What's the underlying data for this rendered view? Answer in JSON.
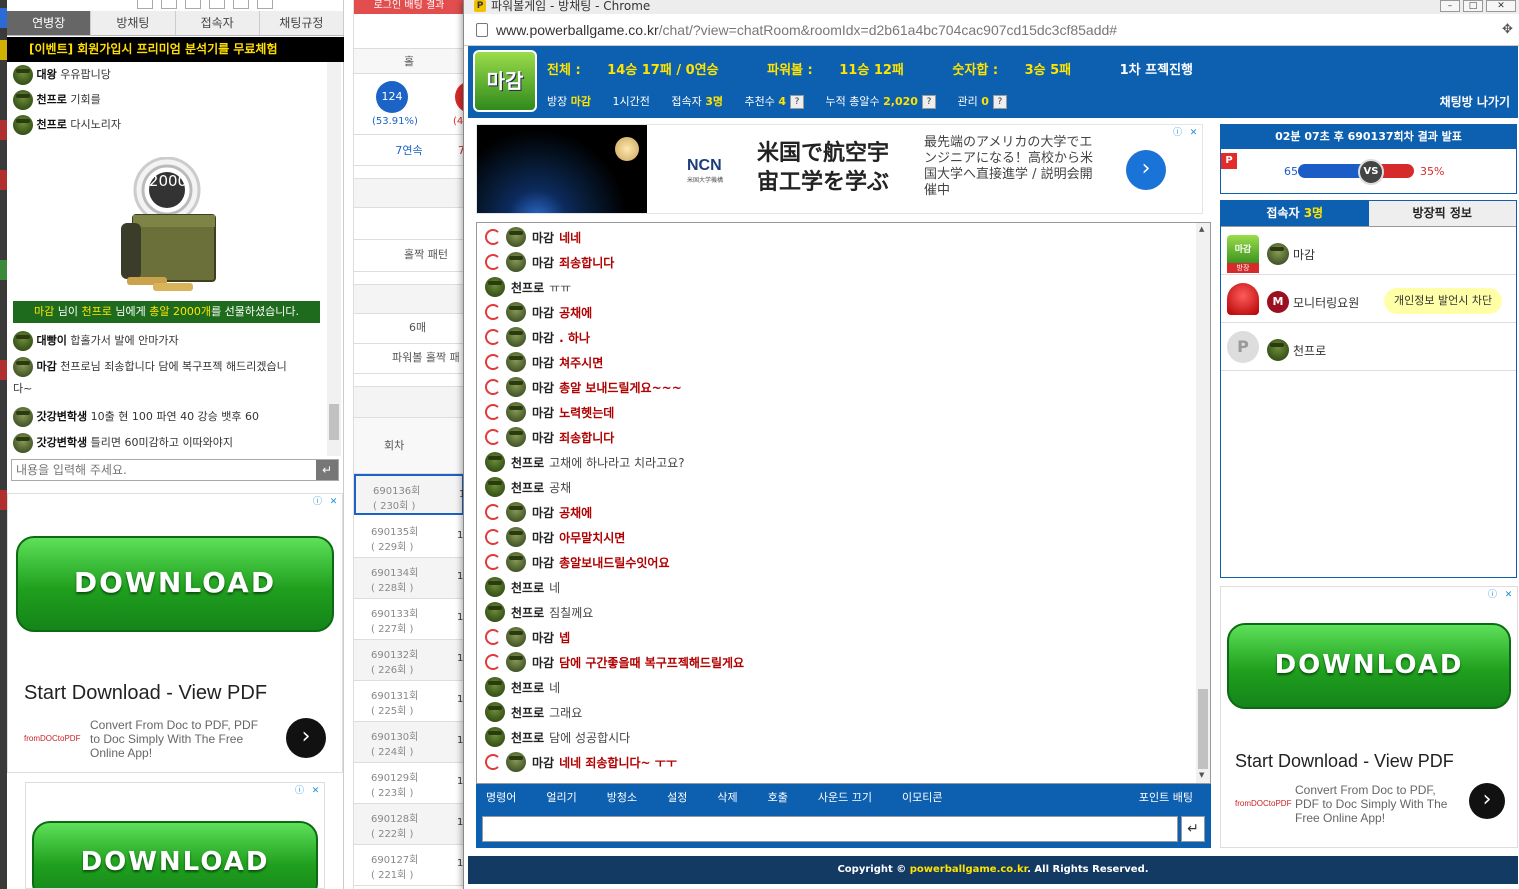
{
  "left": {
    "tabs": [
      "연병장",
      "방채팅",
      "접속자",
      "채팅규정"
    ],
    "event": "[이벤트] 회원가입시 프리미엄 분석기를 무료체험",
    "chat": [
      {
        "nick": "대왕",
        "text": "우유팝니당"
      },
      {
        "nick": "천프로",
        "text": "기회를"
      },
      {
        "nick": "천프로",
        "text": "다시노리자"
      },
      {
        "nick": "대빵이",
        "text": "합홀가서 발에 안마가자"
      },
      {
        "nick": "마감",
        "text": "천프로님 죄송합니다 담에 복구프젝 해드리겠습니"
      },
      {
        "nick": "",
        "text": "다~"
      },
      {
        "nick": "갓강변학생",
        "text": "10출 현 100 파연 40 강승 뱃후 60"
      },
      {
        "nick": "갓강변학생",
        "text": "틀리면 60미감하고 이따와야지"
      }
    ],
    "gift": {
      "amount": "2000",
      "from": "마감",
      "mid1": " 님이 ",
      "to": "천프로",
      "mid2": " 님에게 ",
      "item": "총알 2000개",
      "end": "를 선물하셨습니다."
    },
    "input_placeholder": "내용을 입력해 주세요.",
    "send_glyph": "↵",
    "ad1": {
      "button": "DOWNLOAD",
      "title": "Start Download - View PDF",
      "desc": "Convert From Doc to PDF, PDF to Doc Simply With The Free Online App!",
      "logo": "fromDOCtoPDF"
    },
    "ad2": {
      "button": "DOWNLOAD"
    }
  },
  "middle": {
    "top_btn": "로그인 배팅 결과",
    "odd_label": "홀",
    "odd_count": "124",
    "odd_pct": "(53.91%)",
    "other_pct": "(4",
    "streak": "7연속",
    "streak2": "7",
    "pattern": "홀짝 패턴",
    "six": "6매",
    "pattern2": "파워볼 홀짝 패",
    "round_hdr": "회차",
    "rounds": [
      {
        "no": "690136회",
        "sub": "( 230회 )",
        "v": "1"
      },
      {
        "no": "690135회",
        "sub": "( 229회 )",
        "v": "1"
      },
      {
        "no": "690134회",
        "sub": "( 228회 )",
        "v": "1"
      },
      {
        "no": "690133회",
        "sub": "( 227회 )",
        "v": "1"
      },
      {
        "no": "690132회",
        "sub": "( 226회 )",
        "v": "1"
      },
      {
        "no": "690131회",
        "sub": "( 225회 )",
        "v": "1"
      },
      {
        "no": "690130회",
        "sub": "( 224회 )",
        "v": "1"
      },
      {
        "no": "690129회",
        "sub": "( 223회 )",
        "v": "1"
      },
      {
        "no": "690128회",
        "sub": "( 222회 )",
        "v": "1"
      },
      {
        "no": "690127회",
        "sub": "( 221회 )",
        "v": "1"
      }
    ]
  },
  "window": {
    "title": "파워볼게임 - 방채팅 - Chrome",
    "favicon": "P",
    "url_host": "www.powerballgame.co.kr",
    "url_path": "/chat/?view=chatRoom&roomIdx=d2b61a4bc704cac907cd15dc3cf85add#"
  },
  "room": {
    "logo": "마감",
    "stats": [
      {
        "label": "전체 : ",
        "value": "14승 17패 / 0연승"
      },
      {
        "label": "파워볼 : ",
        "value": "11승 12패"
      },
      {
        "label": "숫자합 : ",
        "value": "3승 5패"
      },
      {
        "label": "",
        "value": "1차 프젝진행"
      }
    ],
    "owner_label": "방장",
    "owner": "마감",
    "duration": "1시간전",
    "users_label": "접속자",
    "users": "3명",
    "recommend_label": "추천수",
    "recommend": "4",
    "bullets_label": "누적 총알수",
    "bullets": "2,020",
    "manage_label": "관리",
    "manage": "0",
    "exit": "채팅방 나가기"
  },
  "top_ad": {
    "brand": "NCN",
    "brand_sub": "米国大学機構",
    "headline": "米国で航空宇宙工学を学ぶ",
    "body": "最先端のアメリカの大学でエンジニアになる！高校から米国大学へ直接進学 / 説明会開催中"
  },
  "messages": [
    {
      "nick": "마감",
      "text": "네네",
      "red": true,
      "av": "olv"
    },
    {
      "nick": "마감",
      "text": "죄송합니다",
      "red": true,
      "av": "olv"
    },
    {
      "nick": "천프로",
      "text": "ㅠㅠ",
      "red": false,
      "av": "grn"
    },
    {
      "nick": "마감",
      "text": "공채에",
      "red": true,
      "av": "olv"
    },
    {
      "nick": "마감",
      "text": ". 하나",
      "red": true,
      "av": "olv"
    },
    {
      "nick": "마감",
      "text": "쳐주시면",
      "red": true,
      "av": "olv"
    },
    {
      "nick": "마감",
      "text": "총알 보내드릴게요~~~",
      "red": true,
      "av": "olv"
    },
    {
      "nick": "마감",
      "text": "노력헷는데",
      "red": true,
      "av": "olv"
    },
    {
      "nick": "마감",
      "text": "죄송합니다",
      "red": true,
      "av": "olv"
    },
    {
      "nick": "천프로",
      "text": "고채에 하나라고 치라고요?",
      "red": false,
      "av": "grn"
    },
    {
      "nick": "천프로",
      "text": "공채",
      "red": false,
      "av": "grn"
    },
    {
      "nick": "마감",
      "text": "공채에",
      "red": true,
      "av": "olv"
    },
    {
      "nick": "마감",
      "text": "아무말치시면",
      "red": true,
      "av": "olv"
    },
    {
      "nick": "마감",
      "text": "총알보내드릴수잇어요",
      "red": true,
      "av": "olv"
    },
    {
      "nick": "천프로",
      "text": "네",
      "red": false,
      "av": "grn"
    },
    {
      "nick": "천프로",
      "text": "짐칠께요",
      "red": false,
      "av": "grn"
    },
    {
      "nick": "마감",
      "text": "넵",
      "red": true,
      "av": "olv"
    },
    {
      "nick": "마감",
      "text": "담에 구간좋을때 복구프젝해드릴게요",
      "red": true,
      "av": "olv"
    },
    {
      "nick": "천프로",
      "text": "네",
      "red": false,
      "av": "grn"
    },
    {
      "nick": "천프로",
      "text": "그래요",
      "red": false,
      "av": "grn"
    },
    {
      "nick": "천프로",
      "text": "담에 성공합시다",
      "red": false,
      "av": "grn"
    },
    {
      "nick": "마감",
      "text": "네네 죄송합니다~ ㅜㅜ",
      "red": true,
      "av": "olv"
    }
  ],
  "toolbar": [
    "명령어",
    "얼리기",
    "방청소",
    "설정",
    "삭제",
    "호출",
    "사운드 끄기",
    "이모티콘"
  ],
  "toolbar_right": "포인트 배팅",
  "send_glyph": "↵",
  "footer": {
    "pre": "Copyright © ",
    "site": "powerballgame.co.kr",
    "post": ". All Rights Reserved."
  },
  "result": {
    "header": "02분 07초 후 690137회차 결과 발표",
    "badge": "P",
    "left_pct": "65%",
    "right_pct": "35%",
    "left_share": 65,
    "vs": "VS"
  },
  "user_tabs": {
    "users_label": "접속자 ",
    "users_count": "3명",
    "info": "방장픽 정보"
  },
  "user_list": [
    {
      "name": "마감",
      "badge": "방장",
      "tip": ""
    },
    {
      "name": "모니터링요원",
      "badge": "",
      "tip": "개인정보 발언시 차단"
    },
    {
      "name": "천프로",
      "badge": "",
      "tip": ""
    }
  ],
  "right_ad": {
    "button": "DOWNLOAD",
    "title": "Start Download - View PDF",
    "desc": "Convert From Doc to PDF, PDF to Doc Simply With The Free Online App!",
    "logo": "fromDOCtoPDF"
  }
}
